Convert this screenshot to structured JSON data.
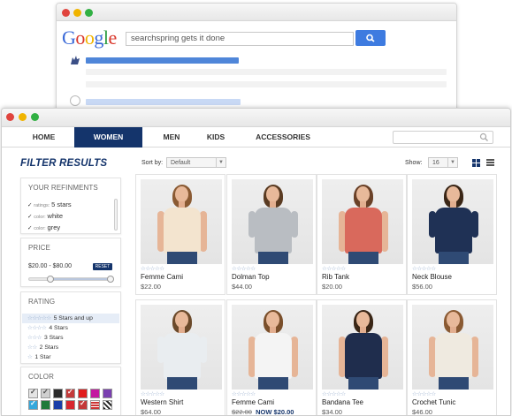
{
  "google": {
    "logo_letters": [
      "G",
      "o",
      "o",
      "g",
      "l",
      "e"
    ],
    "query": "searchspring gets it done"
  },
  "store": {
    "nav": {
      "items": [
        {
          "label": "HOME",
          "active": false
        },
        {
          "label": "WOMEN",
          "active": true
        },
        {
          "label": "MEN",
          "active": false
        },
        {
          "label": "KIDS",
          "active": false
        },
        {
          "label": "ACCESSORIES",
          "active": false
        }
      ]
    },
    "sidebar": {
      "title": "FILTER RESULTS",
      "refinements": {
        "title": "YOUR REFINMENTS",
        "items": [
          {
            "key": "ratings:",
            "value": "5 stars"
          },
          {
            "key": "color:",
            "value": "white"
          },
          {
            "key": "color:",
            "value": "grey"
          }
        ]
      },
      "price": {
        "title": "PRICE",
        "range": "$20.00 - $80.00",
        "reset_label": "RESET",
        "low_fraction": 0.25,
        "high_fraction": 0.98
      },
      "rating": {
        "title": "RATING",
        "items": [
          {
            "stars": "☆☆☆☆☆",
            "label": "5 Stars and up"
          },
          {
            "stars": "☆☆☆☆",
            "label": "4 Stars"
          },
          {
            "stars": "☆☆☆",
            "label": "3 Stars"
          },
          {
            "stars": "☆☆",
            "label": "2 Stars"
          },
          {
            "stars": "☆",
            "label": "1 Star"
          }
        ]
      },
      "color": {
        "title": "COLOR",
        "swatches": [
          "#e4e4e4",
          "#cfcfcf",
          "#2a2a2a",
          "#c43a3a",
          "#e01c1c",
          "#c41aa0",
          "#7a3fb0",
          "#35a8dc",
          "#1f7a3a",
          "#1a3ea8",
          "#d8262e",
          "#c43a3a",
          "#ffffff",
          "#222222"
        ]
      }
    },
    "toolbar": {
      "sort_label": "Sort by:",
      "sort_value": "Default",
      "show_label": "Show:",
      "show_value": "16"
    },
    "products": [
      {
        "name": "Femme Cami",
        "price": "$22.00",
        "stars": "☆☆☆☆☆",
        "top": "#f3e4cf",
        "hair": "#8a5a33",
        "sleeve": false
      },
      {
        "name": "Dolman Top",
        "price": "$44.00",
        "stars": "☆☆☆☆☆",
        "top": "#b9bdc2",
        "hair": "#5a3b22",
        "sleeve": true
      },
      {
        "name": "Rib Tank",
        "price": "$20.00",
        "stars": "☆☆☆☆☆",
        "top": "#d9695c",
        "hair": "#6a4128",
        "sleeve": false
      },
      {
        "name": "Neck Blouse",
        "price": "$56.00",
        "stars": "☆☆☆☆☆",
        "top": "#1f3155",
        "hair": "#3a2616",
        "sleeve": true
      },
      {
        "name": "Western Shirt",
        "price": "$64.00",
        "stars": "☆☆☆☆☆",
        "top": "#e9edf0",
        "hair": "#6b4a2b",
        "sleeve": true
      },
      {
        "name": "Femme Cami",
        "old_price": "$22.00",
        "now_price": "NOW $20.00",
        "stars": "☆☆☆☆☆",
        "top": "#f4f4f4",
        "hair": "#7a4f2b",
        "sleeve": false
      },
      {
        "name": "Bandana Tee",
        "price": "$34.00",
        "stars": "☆☆☆☆☆",
        "top": "#1f2d4d",
        "hair": "#3a2616",
        "sleeve": false
      },
      {
        "name": "Crochet Tunic",
        "price": "$46.00",
        "stars": "☆☆☆☆☆",
        "top": "#efeae0",
        "hair": "#8a5a33",
        "sleeve": false
      }
    ]
  }
}
